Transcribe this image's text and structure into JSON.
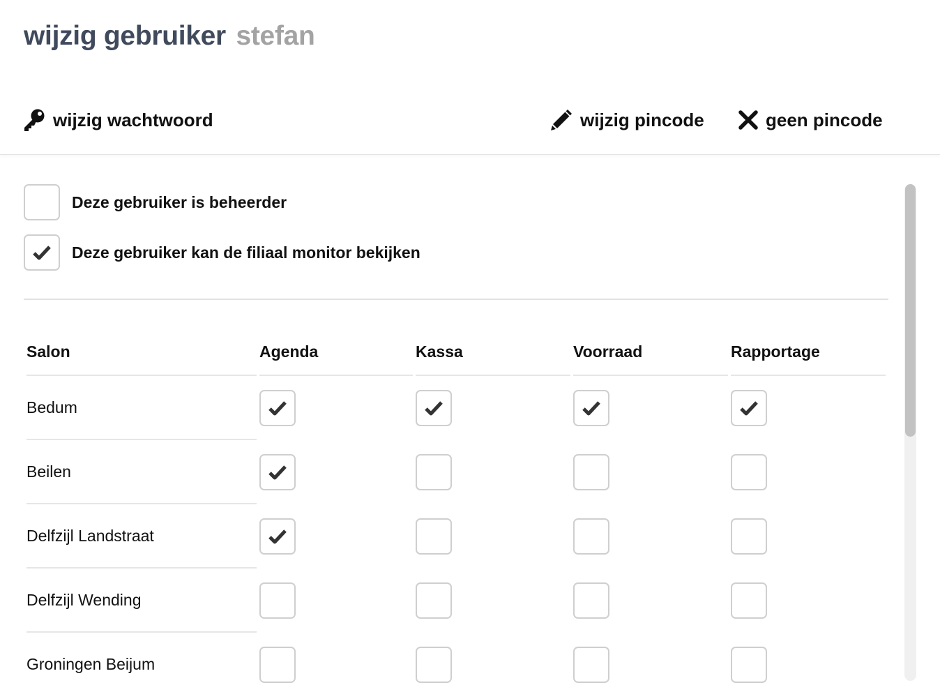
{
  "header": {
    "title": "wijzig gebruiker",
    "username": "stefan",
    "actions": {
      "change_password": "wijzig wachtwoord",
      "change_pin": "wijzig pincode",
      "no_pin": "geen pincode"
    }
  },
  "options": {
    "admin": {
      "label": "Deze gebruiker is beheerder",
      "checked": false
    },
    "monitor": {
      "label": "Deze gebruiker kan de filiaal monitor bekijken",
      "checked": true
    }
  },
  "table": {
    "columns": [
      "Salon",
      "Agenda",
      "Kassa",
      "Voorraad",
      "Rapportage"
    ],
    "rows": [
      {
        "salon": "Bedum",
        "perms": [
          true,
          true,
          true,
          true
        ]
      },
      {
        "salon": "Beilen",
        "perms": [
          true,
          false,
          false,
          false
        ]
      },
      {
        "salon": "Delfzijl Landstraat",
        "perms": [
          true,
          false,
          false,
          false
        ]
      },
      {
        "salon": "Delfzijl Wending",
        "perms": [
          false,
          false,
          false,
          false
        ]
      },
      {
        "salon": "Groningen Beijum",
        "perms": [
          false,
          false,
          false,
          false
        ]
      }
    ]
  },
  "icons": {
    "change_password": "key-icon",
    "change_pin": "pencil-icon",
    "no_pin": "close-icon",
    "checked": "checkmark-icon"
  }
}
